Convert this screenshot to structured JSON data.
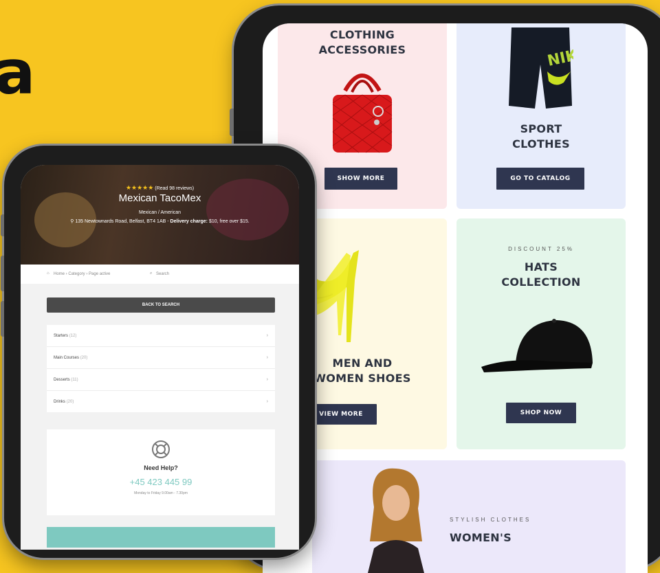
{
  "edge_letter": "a",
  "right_phone": {
    "cards": [
      {
        "title_line1": "CLOTHING",
        "title_line2": "ACCESSORIES",
        "button": "SHOW MORE",
        "bg": "#fce8ea"
      },
      {
        "title_line1": "SPORT",
        "title_line2": "CLOTHES",
        "button": "GO TO CATALOG",
        "bg": "#e7ecfb"
      },
      {
        "title_line1": "MEN AND",
        "title_line2": "WOMEN SHOES",
        "button": "VIEW MORE",
        "bg": "#fef9e3"
      },
      {
        "subtitle": "DISCOUNT 25%",
        "title_line1": "HATS",
        "title_line2": "COLLECTION",
        "button": "SHOP NOW",
        "bg": "#e4f6ea"
      },
      {
        "subtitle": "STYLISH CLOTHES",
        "title_line1": "WOMEN'S",
        "bg": "#ece8fa"
      }
    ]
  },
  "left_phone": {
    "rating_text": "(Read 98 reviews)",
    "stars": "★★★★★",
    "restaurant": "Mexican TacoMex",
    "cuisine": "Mexican / American",
    "address": "135 Newtownards Road, Belfast, BT4 1AB -",
    "delivery_label": "Delivery charge:",
    "delivery_value": "$10, free over $15.",
    "breadcrumb": "Home › Category › Page active",
    "search_label": "Search",
    "back_button": "BACK TO SEARCH",
    "menu": [
      {
        "label": "Starters",
        "count": "(12)"
      },
      {
        "label": "Main Courses",
        "count": "(20)"
      },
      {
        "label": "Desserts",
        "count": "(11)"
      },
      {
        "label": "Drinks",
        "count": "(20)"
      }
    ],
    "help_title": "Need Help?",
    "help_phone": "+45 423 445 99",
    "help_hours": "Monday to Friday 9.00am - 7.30pm",
    "accent": "#7ec9c0"
  }
}
